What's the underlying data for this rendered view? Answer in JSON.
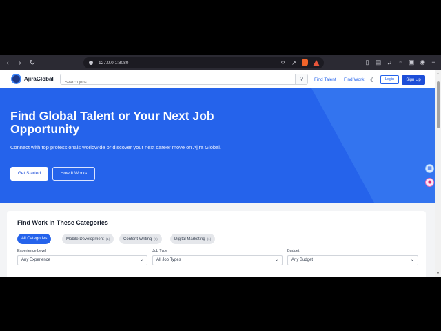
{
  "browser": {
    "url": "127.0.0.1:8080",
    "back_icon": "chevron-left-icon",
    "forward_icon": "chevron-right-icon"
  },
  "header": {
    "brand": "AjiraGlobal",
    "search_placeholder": "Search jobs...",
    "nav": [
      "Find Talent",
      "Find Work"
    ],
    "login": "Login",
    "signup": "Sign Up"
  },
  "hero": {
    "title": "Find Global Talent or Your Next Job Opportunity",
    "subtitle": "Connect with top professionals worldwide or discover your next career move on Ajira Global.",
    "cta_primary": "Get Started",
    "cta_secondary": "How It Works"
  },
  "categories": {
    "title": "Find Work in These Categories",
    "chips": [
      {
        "label": "All Categories",
        "count": ""
      },
      {
        "label": "Mobile Development",
        "count": "(1)"
      },
      {
        "label": "Content Writing",
        "count": "(1)"
      },
      {
        "label": "Digital Marketing",
        "count": "(1)"
      }
    ],
    "filters": [
      {
        "label": "Experience Level",
        "value": "Any Experience"
      },
      {
        "label": "Job Type",
        "value": "All Job Types"
      },
      {
        "label": "Budget",
        "value": "Any Budget"
      }
    ]
  },
  "colors": {
    "primary": "#2563eb",
    "hero_bg": "#2563eb",
    "toolbar_bg": "#2b2a33"
  }
}
